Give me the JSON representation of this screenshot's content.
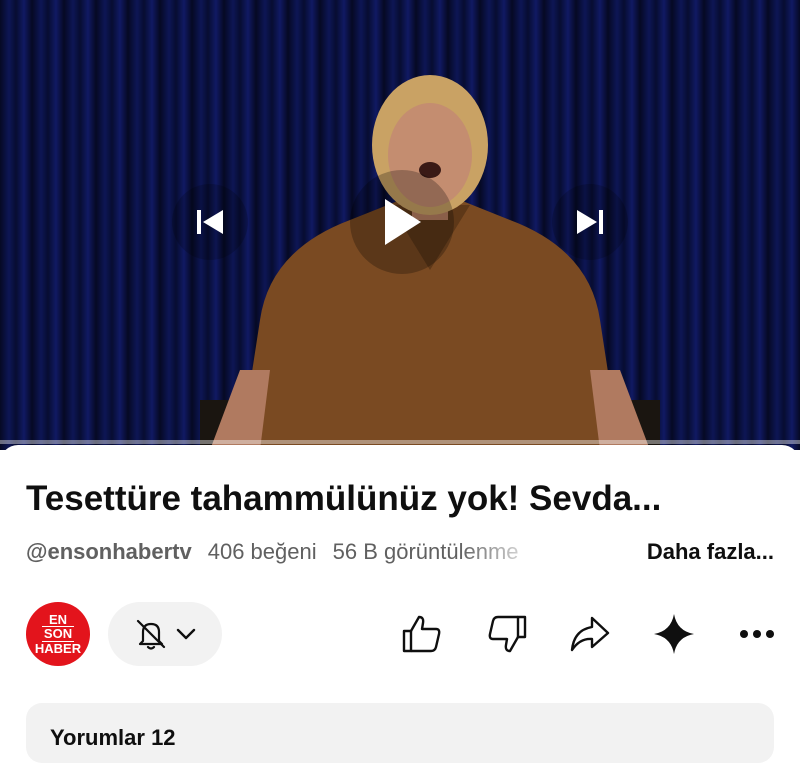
{
  "player": {
    "progress": 0.0,
    "controls": {
      "previous": "previous-icon",
      "play": "play-icon",
      "next": "next-icon"
    }
  },
  "video": {
    "title": "Tesettüre tahammülünüz yok! Sevda...",
    "channel_handle": "@ensonhabertv",
    "likes_text": "406 beğeni",
    "views_text": "56 B görüntülenme",
    "more_label": "Daha fazla..."
  },
  "channel": {
    "avatar_lines": [
      "EN",
      "SON",
      "HABER"
    ],
    "avatar_color": "#e3141c"
  },
  "actions": {
    "icons": [
      "bell-off-icon",
      "like-icon",
      "dislike-icon",
      "share-icon",
      "sparkle-icon",
      "more-icon"
    ]
  },
  "comments": {
    "label": "Yorumlar 12"
  }
}
